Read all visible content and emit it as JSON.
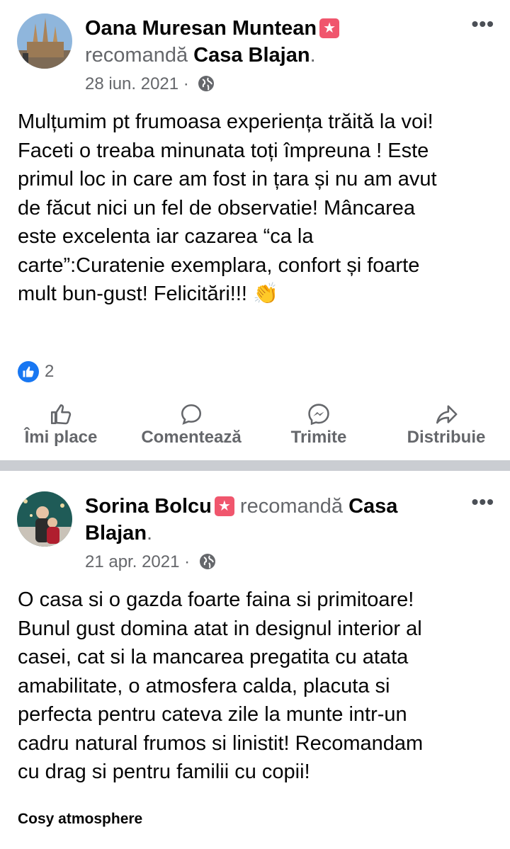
{
  "posts": [
    {
      "author": "Oana Muresan Muntean",
      "recommends": "recomandă",
      "page": "Casa Blajan",
      "date": "28 iun. 2021",
      "separator": "·",
      "text": "Mulțumim pt frumoasa experiența trăită la voi!\nFaceti o treaba minunata toți împreuna ! Este\nprimul loc in care am fost in țara și nu am avut\nde făcut nici un fel de observatie! Mâncarea\neste excelenta iar cazarea “ca la\ncarte”:Curatenie exemplara, confort și foarte\nmult bun-gust! Felicitări!!! 👏",
      "reaction_count": "2",
      "actions": [
        "Îmi place",
        "Comentează",
        "Trimite",
        "Distribuie"
      ]
    },
    {
      "author": "Sorina Bolcu",
      "recommends": "recomandă",
      "page": "Casa Blajan",
      "date": "21 apr. 2021",
      "separator": "·",
      "text": "O casa si o gazda foarte faina si primitoare!\nBunul gust domina atat in designul interior al\ncasei, cat si la mancarea pregatita cu atata\namabilitate, o atmosfera calda, placuta si\nperfecta pentru cateva zile la munte intr-un\ncadru natural frumos si linistit! Recomandam\ncu drag si pentru familii cu copii!",
      "tag": "Cosy atmosphere"
    }
  ],
  "icons": {
    "badge": "star-badge",
    "privacy": "globe-icon",
    "menu": "more-options-icon",
    "like": "thumbs-up-icon",
    "comment": "comment-icon",
    "send": "messenger-icon",
    "share": "share-icon"
  },
  "colors": {
    "accent": "#1877f2",
    "badge": "#f0566d",
    "secondary_text": "#65676b",
    "divider": "#cacdd2"
  }
}
